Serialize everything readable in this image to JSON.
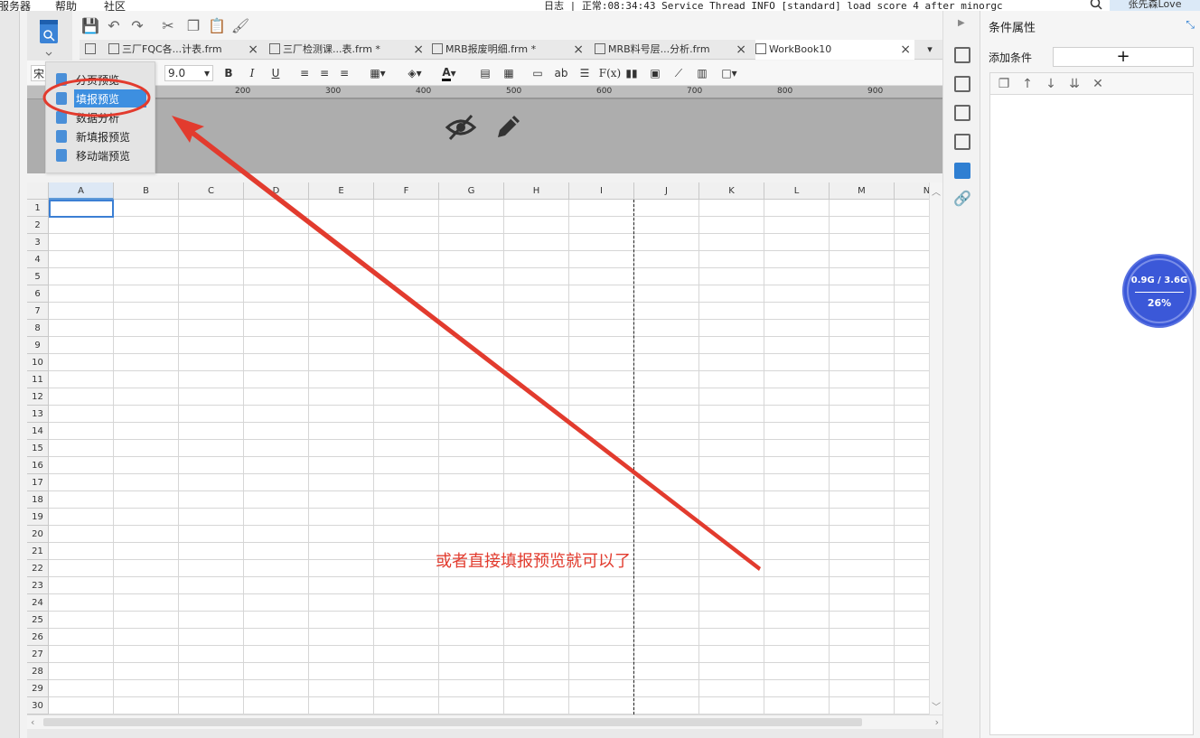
{
  "topbar": {
    "menu": [
      "服务器",
      "帮助",
      "社区"
    ],
    "status": "日志 | 正常:08:34:43 Service Thread INFO [standard] load score 4 after minorgc",
    "user": "张先森Love"
  },
  "preview_menu": {
    "items": [
      {
        "label": "分页预览",
        "selected": false
      },
      {
        "label": "填报预览",
        "selected": true
      },
      {
        "label": "数据分析",
        "selected": false
      },
      {
        "label": "新填报预览",
        "selected": false
      },
      {
        "label": "移动端预览",
        "selected": false
      }
    ]
  },
  "tabs": [
    {
      "label": "三厂FQC各...计表.frm",
      "active": false
    },
    {
      "label": "三厂检测课...表.frm *",
      "active": false
    },
    {
      "label": "MRB报废明细.frm *",
      "active": false
    },
    {
      "label": "MRB料号层...分析.frm",
      "active": false
    },
    {
      "label": "WorkBook10",
      "active": true
    }
  ],
  "format_toolbar": {
    "font_name": "宋",
    "font_size": "9.0",
    "bold": "B",
    "italic": "I",
    "underline": "U",
    "text_style": "ab",
    "formula": "F(x)"
  },
  "ruler": {
    "ticks": [
      "200",
      "300",
      "400",
      "500",
      "600",
      "700",
      "800",
      "900"
    ]
  },
  "columns": [
    "A",
    "B",
    "C",
    "D",
    "E",
    "F",
    "G",
    "H",
    "I",
    "J",
    "K",
    "L",
    "M",
    "N"
  ],
  "rows": [
    "1",
    "2",
    "3",
    "4",
    "5",
    "6",
    "7",
    "8",
    "9",
    "10",
    "11",
    "12",
    "13",
    "14",
    "15",
    "16",
    "17",
    "18",
    "19",
    "20",
    "21",
    "22",
    "23",
    "24",
    "25",
    "26",
    "27",
    "28",
    "29",
    "30"
  ],
  "selected_cell": "A1",
  "properties": {
    "title": "条件属性",
    "add_condition_label": "添加条件",
    "add_button": "+"
  },
  "memory": {
    "sizes": "0.9G / 3.6G",
    "percent": "26%"
  },
  "annotation": {
    "text": "或者直接填报预览就可以了",
    "color": "#e23b2e"
  },
  "colors": {
    "accent": "#3d8fe0",
    "annotation": "#e23b2e",
    "gauge": "#3b58d8"
  }
}
